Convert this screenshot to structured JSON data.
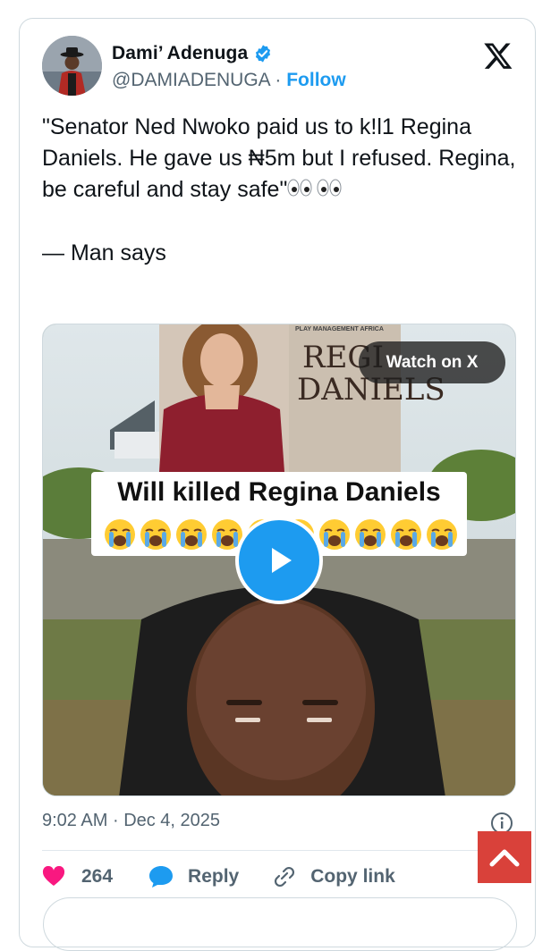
{
  "author": {
    "name": "Dami’ Adenuga",
    "handle": "@DAMIADENUGA",
    "separator": "·",
    "follow_label": "Follow"
  },
  "tweet": {
    "text": "\"Senator Ned Nwoko paid us to k!l1 Regina Daniels. He gave us ₦5m but I refused. Regina, be careful and stay safe\"",
    "eyes_emoji": "👀👀",
    "attribution": "— Man says"
  },
  "media": {
    "watch_label": "Watch on X",
    "banner_small": "PLAY MANAGEMENT AFRICA",
    "banner_title_line1": "REGI",
    "banner_title_line2": "DANIELS",
    "caption": "Will killed Regina Daniels",
    "crying_emoji_count": 10
  },
  "meta": {
    "time": "9:02 AM",
    "separator": "·",
    "date": "Dec 4, 2025"
  },
  "actions": {
    "likes_count": "264",
    "reply_label": "Reply",
    "copy_link_label": "Copy link"
  },
  "colors": {
    "accent": "#1d9bf0",
    "like": "#f91880",
    "scroll_top": "#d9413a"
  }
}
